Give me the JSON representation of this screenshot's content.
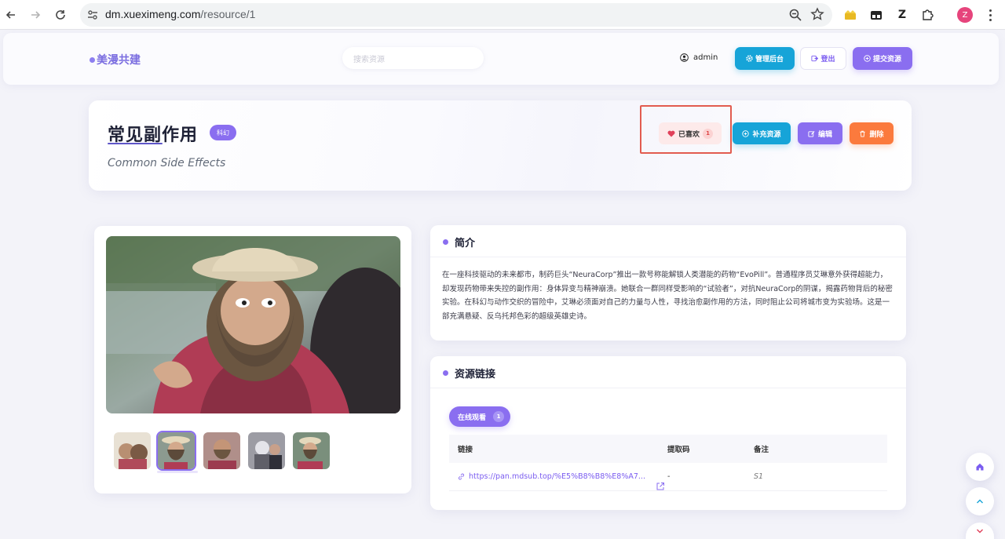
{
  "browser": {
    "url_domain": "dm.xueximeng.com",
    "url_path": "/resource/1",
    "profile_initial": "Z",
    "ext_z": "Z"
  },
  "header": {
    "logo": "美漫共建",
    "search_placeholder": "搜索资源",
    "username": "admin",
    "admin_button": "管理后台",
    "logout_button": "登出",
    "submit_button": "提交资源"
  },
  "resource": {
    "title_cn": "常见副作用",
    "title_en": "Common Side Effects",
    "genre_tag": "科幻",
    "like_label": "已喜欢",
    "like_count": "1",
    "supplement_button": "补充资源",
    "edit_button": "编辑",
    "delete_button": "删除"
  },
  "intro": {
    "heading": "简介",
    "text": "在一座科技驱动的未来都市，制药巨头“NeuraCorp”推出一款号称能解锁人类潜能的药物“EvoPill”。普通程序员艾琳意外获得超能力，却发现药物带来失控的副作用：身体异变与精神崩溃。她联合一群同样受影响的“试验者”，对抗NeuraCorp的阴谋，揭露药物背后的秘密实验。在科幻与动作交织的冒险中，艾琳必须面对自己的力量与人性，寻找治愈副作用的方法，同时阻止公司将城市变为实验场。这是一部充满悬疑、反乌托邦色彩的超级英雄史诗。"
  },
  "links": {
    "heading": "资源链接",
    "tab_label": "在线观看",
    "tab_count": "1",
    "columns": [
      "链接",
      "提取码",
      "备注"
    ],
    "rows": [
      {
        "link": "https://pan.mdsub.top/%E5%B8%B8%E8%A7...",
        "code": "-",
        "note": "S1"
      }
    ]
  },
  "colors": {
    "accent": "#8a6ef0",
    "cyan": "#16a4d8",
    "orange": "#fb7a3d",
    "highlight": "#e25c4f"
  }
}
